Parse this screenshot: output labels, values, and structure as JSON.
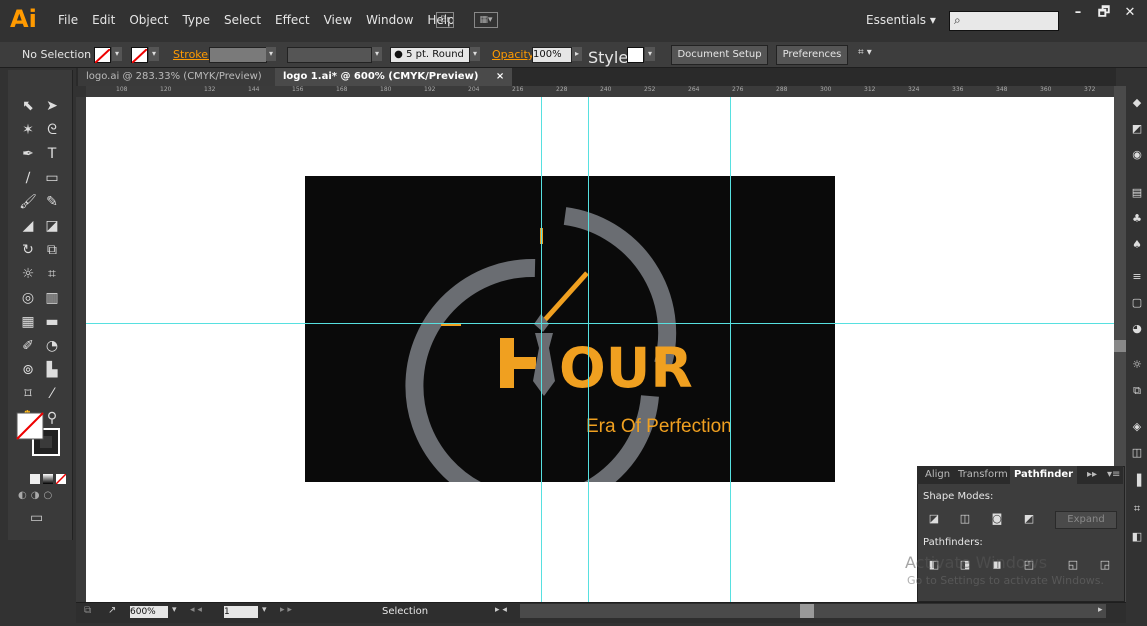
{
  "app": {
    "logo": "Ai",
    "brand_color": "#ff9a00"
  },
  "menu": [
    "File",
    "Edit",
    "Object",
    "Type",
    "Select",
    "Effect",
    "View",
    "Window",
    "Help"
  ],
  "menubar_icons": [
    "bridge-icon",
    "arrange-documents-icon"
  ],
  "menubar_bridge_label": "Br",
  "workspace": {
    "label": "Essentials",
    "chevron": "▾"
  },
  "search": {
    "placeholder": "",
    "icon": "⌕"
  },
  "window_controls": [
    "–",
    "🗗",
    "✕"
  ],
  "control_bar": {
    "selection": "No Selection",
    "stroke_label": "Stroke:",
    "brush": "5 pt. Round",
    "opacity_label": "Opacity:",
    "opacity_value": "100%",
    "style_label": "Style:",
    "document_setup": "Document Setup",
    "preferences": "Preferences"
  },
  "tabs": [
    {
      "label": "logo.ai @ 283.33% (CMYK/Preview)",
      "close": "×"
    },
    {
      "label": "logo 1.ai* @ 600% (CMYK/Preview)",
      "close": "×"
    }
  ],
  "ruler_ticks": [
    "108",
    "120",
    "132",
    "144",
    "156",
    "168",
    "180",
    "192",
    "204",
    "216",
    "228",
    "240",
    "252",
    "264",
    "276",
    "288",
    "300",
    "312",
    "324",
    "336",
    "348",
    "360",
    "372"
  ],
  "logo_art": {
    "wordmark": "OUR",
    "tagline": "Era Of Perfection",
    "colors": {
      "ring": "#6a6d72",
      "accent": "#f0a020",
      "artboard": "#0a0a0a"
    }
  },
  "pathfinder_panel": {
    "tabs": [
      "Align",
      "Transform",
      "Pathfinder"
    ],
    "shape_modes_label": "Shape Modes:",
    "expand_label": "Expand",
    "pathfinders_label": "Pathfinders:"
  },
  "watermark": {
    "title": "Activate Windows",
    "subtitle": "Go to Settings to activate Windows."
  },
  "status_bar": {
    "zoom": "600%",
    "page": "1",
    "status": "Selection"
  }
}
